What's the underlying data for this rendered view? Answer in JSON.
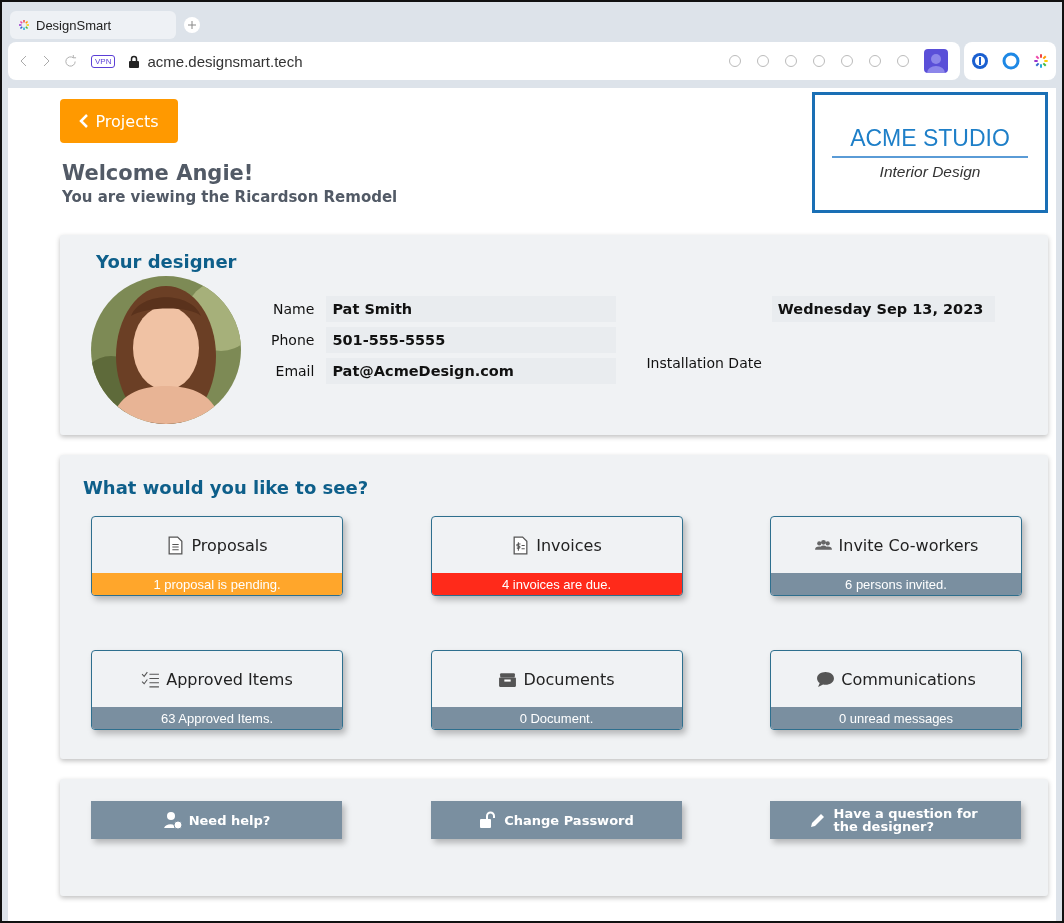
{
  "browser": {
    "tab_title": "DesignSmart",
    "vpn_badge": "VPN",
    "url": "acme.designsmart.tech"
  },
  "back_button": {
    "label": "Projects"
  },
  "welcome": {
    "title": "Welcome Angie!",
    "subtitle": "You are viewing the Ricardson Remodel"
  },
  "logo": {
    "name": "ACME STUDIO",
    "tagline": "Interior Design"
  },
  "designer": {
    "heading": "Your designer",
    "fields": [
      {
        "label": "Name",
        "value": "Pat Smith"
      },
      {
        "label": "Phone",
        "value": "501-555-5555"
      },
      {
        "label": "Email",
        "value": "Pat@AcmeDesign.com"
      }
    ],
    "installation": {
      "label": "Installation Date",
      "value": "Wednesday Sep 13, 2023"
    }
  },
  "options": {
    "heading": "What would you like to see?",
    "tiles": [
      {
        "title": "Proposals",
        "status": "1 proposal is pending.",
        "color": "#ffa62b"
      },
      {
        "title": "Invoices",
        "status": "4 invoices are due.",
        "color": "#ff2a1a"
      },
      {
        "title": "Invite Co-workers",
        "status": "6 persons invited.",
        "color": "#7a8fa0"
      },
      {
        "title": "Approved Items",
        "status": "63 Approved Items.",
        "color": "#7a8fa0"
      },
      {
        "title": "Documents",
        "status": "0 Document.",
        "color": "#7a8fa0"
      },
      {
        "title": "Communications",
        "status": "0 unread messages",
        "color": "#7a8fa0"
      }
    ]
  },
  "actions": [
    {
      "label": "Need help?"
    },
    {
      "label": "Change Password"
    },
    {
      "label": "Have a question for the designer?"
    }
  ]
}
